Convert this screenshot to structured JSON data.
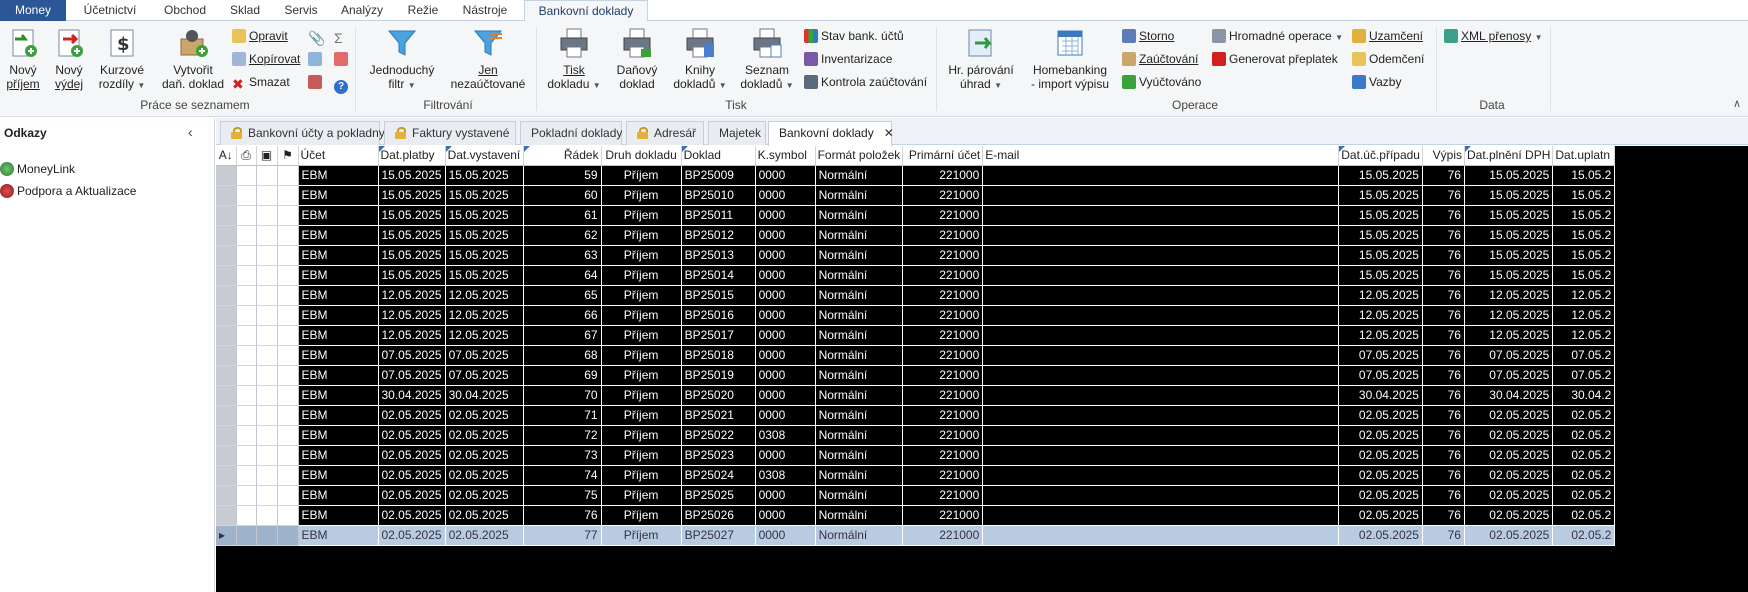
{
  "menu": {
    "app_button": "Money",
    "tabs": [
      "Účetnictví",
      "Obchod",
      "Sklad",
      "Servis",
      "Analýzy",
      "Režie",
      "Nástroje"
    ],
    "active_tab": "Bankovní doklady"
  },
  "ribbon": {
    "groups": {
      "prace": "Práce se seznamem",
      "filtrovani": "Filtrování",
      "tisk": "Tisk",
      "operace": "Operace",
      "data": "Data"
    },
    "novy_prijem": [
      "Nový",
      "příjem"
    ],
    "novy_vydej": [
      "Nový",
      "výdej"
    ],
    "kurzove": [
      "Kurzové",
      "rozdíly"
    ],
    "vytvorit_dan": [
      "Vytvořit",
      "daň. doklad"
    ],
    "opravit": "Opravit",
    "kopirovat": "Kopírovat",
    "smazat": "Smazat",
    "jednoduchy_filtr": [
      "Jednoduchý",
      "filtr"
    ],
    "jen_nezauctovane": [
      "Jen",
      "nezaúčtované"
    ],
    "tisk_dokladu": [
      "Tisk",
      "dokladu"
    ],
    "danovy_doklad": [
      "Daňový",
      "doklad"
    ],
    "knihy_dokladu": [
      "Knihy",
      "dokladů"
    ],
    "seznam_dokladu": [
      "Seznam",
      "dokladů"
    ],
    "stav_bank": "Stav bank. účtů",
    "inventarizace": "Inventarizace",
    "kontrola": "Kontrola zaúčtování",
    "hr_parovani": [
      "Hr. párování",
      "úhrad"
    ],
    "homebanking": [
      "Homebanking",
      "- import výpisu"
    ],
    "storno": "Storno",
    "zauctovani": "Zaúčtování",
    "vyuctovano": "Vyúčtováno",
    "hromadne": "Hromadné operace",
    "generovat": "Generovat přeplatek",
    "uzamceni": "Uzamčení",
    "odemceni": "Odemčení",
    "vazby": "Vazby",
    "xml": "XML přenosy"
  },
  "sidebar": {
    "title": "Odkazy",
    "items": [
      "MoneyLink",
      "Podpora a Aktualizace"
    ]
  },
  "doc_tabs": [
    {
      "label": "Bankovní účty a pokladny",
      "locked": true
    },
    {
      "label": "Faktury vystavené",
      "locked": true
    },
    {
      "label": "Pokladní doklady",
      "locked": false
    },
    {
      "label": "Adresář",
      "locked": true
    },
    {
      "label": "Majetek",
      "locked": false
    },
    {
      "label": "Bankovní doklady",
      "locked": false,
      "active": true
    }
  ],
  "grid": {
    "columns": [
      "Účet",
      "Dat.platby",
      "Dat.vystavení",
      "Řádek",
      "Druh dokladu",
      "Doklad",
      "K.symbol",
      "Formát položek",
      "Primární účet",
      "E-mail",
      "Dat.úč.případu",
      "Výpis",
      "Dat.plnění DPH",
      "Dat.uplatn"
    ],
    "rows": [
      [
        "EBM",
        "15.05.2025",
        "15.05.2025",
        "59",
        "Příjem",
        "BP25009",
        "0000",
        "Normální",
        "221000",
        "",
        "15.05.2025",
        "76",
        "15.05.2025",
        "15.05.2"
      ],
      [
        "EBM",
        "15.05.2025",
        "15.05.2025",
        "60",
        "Příjem",
        "BP25010",
        "0000",
        "Normální",
        "221000",
        "",
        "15.05.2025",
        "76",
        "15.05.2025",
        "15.05.2"
      ],
      [
        "EBM",
        "15.05.2025",
        "15.05.2025",
        "61",
        "Příjem",
        "BP25011",
        "0000",
        "Normální",
        "221000",
        "",
        "15.05.2025",
        "76",
        "15.05.2025",
        "15.05.2"
      ],
      [
        "EBM",
        "15.05.2025",
        "15.05.2025",
        "62",
        "Příjem",
        "BP25012",
        "0000",
        "Normální",
        "221000",
        "",
        "15.05.2025",
        "76",
        "15.05.2025",
        "15.05.2"
      ],
      [
        "EBM",
        "15.05.2025",
        "15.05.2025",
        "63",
        "Příjem",
        "BP25013",
        "0000",
        "Normální",
        "221000",
        "",
        "15.05.2025",
        "76",
        "15.05.2025",
        "15.05.2"
      ],
      [
        "EBM",
        "15.05.2025",
        "15.05.2025",
        "64",
        "Příjem",
        "BP25014",
        "0000",
        "Normální",
        "221000",
        "",
        "15.05.2025",
        "76",
        "15.05.2025",
        "15.05.2"
      ],
      [
        "EBM",
        "12.05.2025",
        "12.05.2025",
        "65",
        "Příjem",
        "BP25015",
        "0000",
        "Normální",
        "221000",
        "",
        "12.05.2025",
        "76",
        "12.05.2025",
        "12.05.2"
      ],
      [
        "EBM",
        "12.05.2025",
        "12.05.2025",
        "66",
        "Příjem",
        "BP25016",
        "0000",
        "Normální",
        "221000",
        "",
        "12.05.2025",
        "76",
        "12.05.2025",
        "12.05.2"
      ],
      [
        "EBM",
        "12.05.2025",
        "12.05.2025",
        "67",
        "Příjem",
        "BP25017",
        "0000",
        "Normální",
        "221000",
        "",
        "12.05.2025",
        "76",
        "12.05.2025",
        "12.05.2"
      ],
      [
        "EBM",
        "07.05.2025",
        "07.05.2025",
        "68",
        "Příjem",
        "BP25018",
        "0000",
        "Normální",
        "221000",
        "",
        "07.05.2025",
        "76",
        "07.05.2025",
        "07.05.2"
      ],
      [
        "EBM",
        "07.05.2025",
        "07.05.2025",
        "69",
        "Příjem",
        "BP25019",
        "0000",
        "Normální",
        "221000",
        "",
        "07.05.2025",
        "76",
        "07.05.2025",
        "07.05.2"
      ],
      [
        "EBM",
        "30.04.2025",
        "30.04.2025",
        "70",
        "Příjem",
        "BP25020",
        "0000",
        "Normální",
        "221000",
        "",
        "30.04.2025",
        "76",
        "30.04.2025",
        "30.04.2"
      ],
      [
        "EBM",
        "02.05.2025",
        "02.05.2025",
        "71",
        "Příjem",
        "BP25021",
        "0000",
        "Normální",
        "221000",
        "",
        "02.05.2025",
        "76",
        "02.05.2025",
        "02.05.2"
      ],
      [
        "EBM",
        "02.05.2025",
        "02.05.2025",
        "72",
        "Příjem",
        "BP25022",
        "0308",
        "Normální",
        "221000",
        "",
        "02.05.2025",
        "76",
        "02.05.2025",
        "02.05.2"
      ],
      [
        "EBM",
        "02.05.2025",
        "02.05.2025",
        "73",
        "Příjem",
        "BP25023",
        "0000",
        "Normální",
        "221000",
        "",
        "02.05.2025",
        "76",
        "02.05.2025",
        "02.05.2"
      ],
      [
        "EBM",
        "02.05.2025",
        "02.05.2025",
        "74",
        "Příjem",
        "BP25024",
        "0308",
        "Normální",
        "221000",
        "",
        "02.05.2025",
        "76",
        "02.05.2025",
        "02.05.2"
      ],
      [
        "EBM",
        "02.05.2025",
        "02.05.2025",
        "75",
        "Příjem",
        "BP25025",
        "0000",
        "Normální",
        "221000",
        "",
        "02.05.2025",
        "76",
        "02.05.2025",
        "02.05.2"
      ],
      [
        "EBM",
        "02.05.2025",
        "02.05.2025",
        "76",
        "Příjem",
        "BP25026",
        "0000",
        "Normální",
        "221000",
        "",
        "02.05.2025",
        "76",
        "02.05.2025",
        "02.05.2"
      ],
      [
        "EBM",
        "02.05.2025",
        "02.05.2025",
        "77",
        "Příjem",
        "BP25027",
        "0000",
        "Normální",
        "221000",
        "",
        "02.05.2025",
        "76",
        "02.05.2025",
        "02.05.2"
      ]
    ],
    "selected_row": 18
  }
}
